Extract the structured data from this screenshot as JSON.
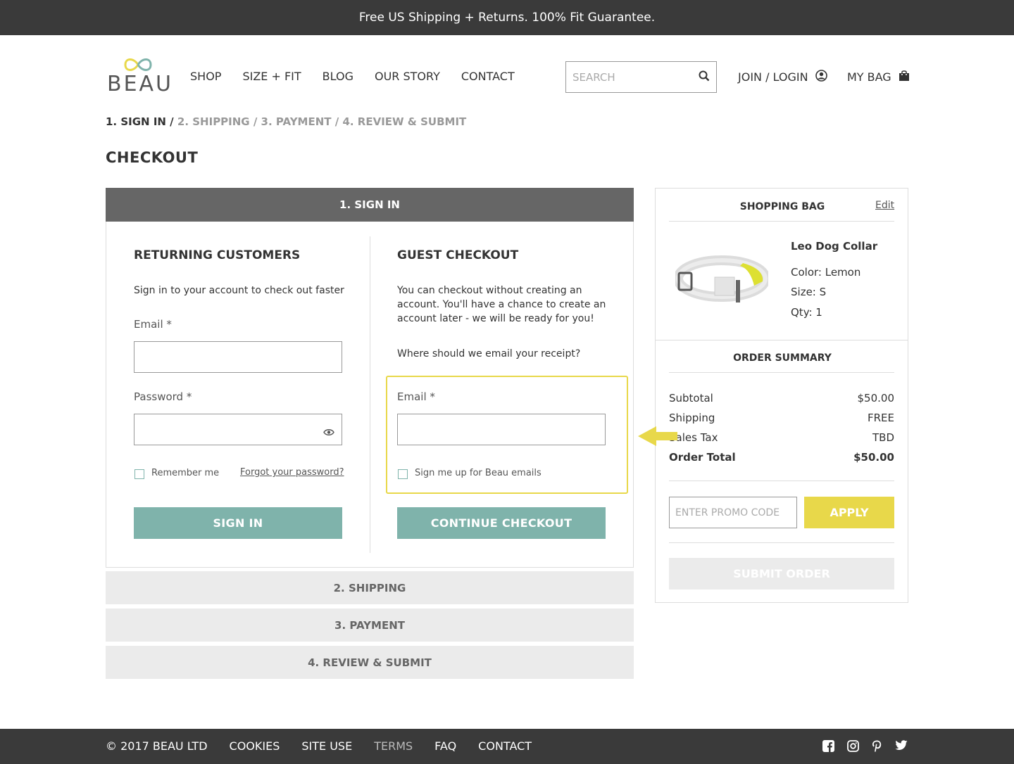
{
  "banner": {
    "text": "Free US Shipping + Returns. 100% Fit Guarantee."
  },
  "brand": {
    "name": "BEAU"
  },
  "nav": {
    "items": [
      "SHOP",
      "SIZE + FIT",
      "BLOG",
      "OUR STORY",
      "CONTACT"
    ]
  },
  "search": {
    "placeholder": "SEARCH",
    "icon": "search-icon"
  },
  "account": {
    "join_label": "JOIN / LOGIN",
    "join_icon": "user-circle-icon",
    "bag_label": "MY BAG",
    "bag_icon": "shopping-bag-icon"
  },
  "breadcrumb": {
    "active": "1. SIGN IN /",
    "rest": " 2. SHIPPING / 3. PAYMENT / 4. REVIEW & SUBMIT"
  },
  "page": {
    "title": "CHECKOUT"
  },
  "signin_panel": {
    "header": "1. SIGN IN",
    "returning": {
      "title": "RETURNING CUSTOMERS",
      "text": "Sign in to your account to check out faster",
      "email_label": "Email *",
      "password_label": "Password *",
      "remember_label": "Remember me",
      "forgot_label": "Forgot your password?",
      "signin_button": "SIGN IN"
    },
    "guest": {
      "title": "GUEST CHECKOUT",
      "text": "You can checkout without creating an account.  You'll have a chance to create an account later - we will be ready for you!",
      "receipt_question": "Where should we email your receipt?",
      "email_label": "Email *",
      "signup_label": "Sign me up for Beau emails",
      "continue_button": "CONTINUE CHECKOUT"
    }
  },
  "steps": [
    "2. SHIPPING",
    "3. PAYMENT",
    "4. REVIEW & SUBMIT"
  ],
  "bag": {
    "title": "SHOPPING BAG",
    "edit_label": "Edit",
    "product": {
      "name": "Leo Dog Collar",
      "color": "Color: Lemon",
      "size": "Size: S",
      "qty": "Qty: 1"
    }
  },
  "summary": {
    "title": "ORDER SUMMARY",
    "rows": [
      {
        "label": "Subtotal",
        "value": "$50.00"
      },
      {
        "label": "Shipping",
        "value": "FREE"
      },
      {
        "label": "Sales Tax",
        "value": "TBD"
      },
      {
        "label": "Order Total",
        "value": "$50.00"
      }
    ],
    "promo_placeholder": "ENTER PROMO CODE",
    "apply_button": "APPLY",
    "submit_button": "SUBMIT ORDER"
  },
  "footer": {
    "links": [
      "© 2017 BEAU LTD",
      "COOKIES",
      "SITE USE",
      "TERMS",
      "FAQ",
      "CONTACT"
    ],
    "social_icons": [
      "facebook-icon",
      "instagram-icon",
      "pinterest-icon",
      "twitter-icon"
    ]
  },
  "colors": {
    "teal": "#7fb3ab",
    "yellow": "#e8d84a",
    "dark": "#3a3a3a",
    "header_gray": "#666666"
  }
}
